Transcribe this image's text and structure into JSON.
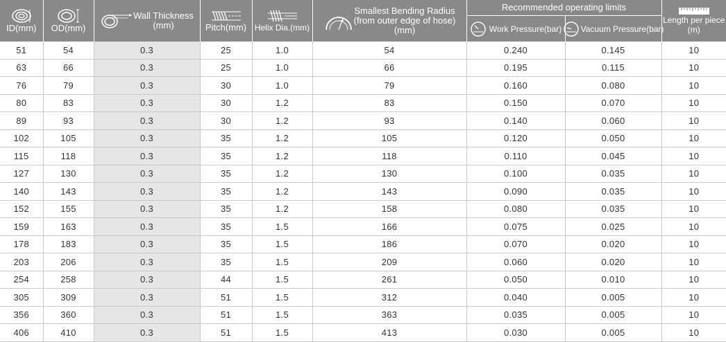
{
  "headers": {
    "id": "ID(mm)",
    "od": "OD(mm)",
    "wall_line1": "Wall Thickness",
    "wall_line2": "(mm)",
    "pitch": "Pitch(mm)",
    "helix": "Helix Dia.(mm)",
    "bend_line1": "Smallest Bending Radius",
    "bend_line2": "(from outer edge of hose)",
    "bend_line3": "(mm)",
    "limits": "Recommended operating limits",
    "work": "Work Pressure(bar)",
    "vacuum": "Vacuum Pressure(bar)",
    "length_line1": "Length per piece",
    "length_line2": "(m)"
  },
  "rows": [
    [
      "51",
      "54",
      "0.3",
      "25",
      "1.0",
      "54",
      "0.240",
      "0.145",
      "10"
    ],
    [
      "63",
      "66",
      "0.3",
      "25",
      "1.0",
      "66",
      "0.195",
      "0.115",
      "10"
    ],
    [
      "76",
      "79",
      "0.3",
      "30",
      "1.0",
      "79",
      "0.160",
      "0.080",
      "10"
    ],
    [
      "80",
      "83",
      "0.3",
      "30",
      "1.2",
      "83",
      "0.150",
      "0.070",
      "10"
    ],
    [
      "89",
      "93",
      "0.3",
      "30",
      "1.2",
      "93",
      "0.140",
      "0.060",
      "10"
    ],
    [
      "102",
      "105",
      "0.3",
      "35",
      "1.2",
      "105",
      "0.120",
      "0.050",
      "10"
    ],
    [
      "115",
      "118",
      "0.3",
      "35",
      "1.2",
      "118",
      "0.110",
      "0.045",
      "10"
    ],
    [
      "127",
      "130",
      "0.3",
      "35",
      "1.2",
      "130",
      "0.100",
      "0.035",
      "10"
    ],
    [
      "140",
      "143",
      "0.3",
      "35",
      "1.2",
      "143",
      "0.090",
      "0.035",
      "10"
    ],
    [
      "152",
      "155",
      "0.3",
      "35",
      "1.2",
      "158",
      "0.080",
      "0.035",
      "10"
    ],
    [
      "159",
      "163",
      "0.3",
      "35",
      "1.5",
      "166",
      "0.075",
      "0.025",
      "10"
    ],
    [
      "178",
      "183",
      "0.3",
      "35",
      "1.5",
      "186",
      "0.070",
      "0.020",
      "10"
    ],
    [
      "203",
      "206",
      "0.3",
      "35",
      "1.5",
      "209",
      "0.060",
      "0.020",
      "10"
    ],
    [
      "254",
      "258",
      "0.3",
      "44",
      "1.5",
      "261",
      "0.050",
      "0.010",
      "10"
    ],
    [
      "305",
      "309",
      "0.3",
      "51",
      "1.5",
      "312",
      "0.040",
      "0.005",
      "10"
    ],
    [
      "356",
      "360",
      "0.3",
      "51",
      "1.5",
      "363",
      "0.035",
      "0.005",
      "10"
    ],
    [
      "406",
      "410",
      "0.3",
      "51",
      "1.5",
      "413",
      "0.030",
      "0.005",
      "10"
    ]
  ],
  "icons": {
    "id": "hose-id-icon",
    "od": "hose-od-icon",
    "wall": "wall-thickness-icon",
    "pitch": "pitch-icon",
    "helix": "helix-icon",
    "bend": "bending-radius-icon",
    "work": "work-pressure-gauge-icon",
    "vacuum": "vacuum-pressure-gauge-icon",
    "length": "length-ruler-icon"
  },
  "colors": {
    "header_bg": "#898989",
    "shaded_cell": "#e6e6e6",
    "text": "#333333"
  }
}
